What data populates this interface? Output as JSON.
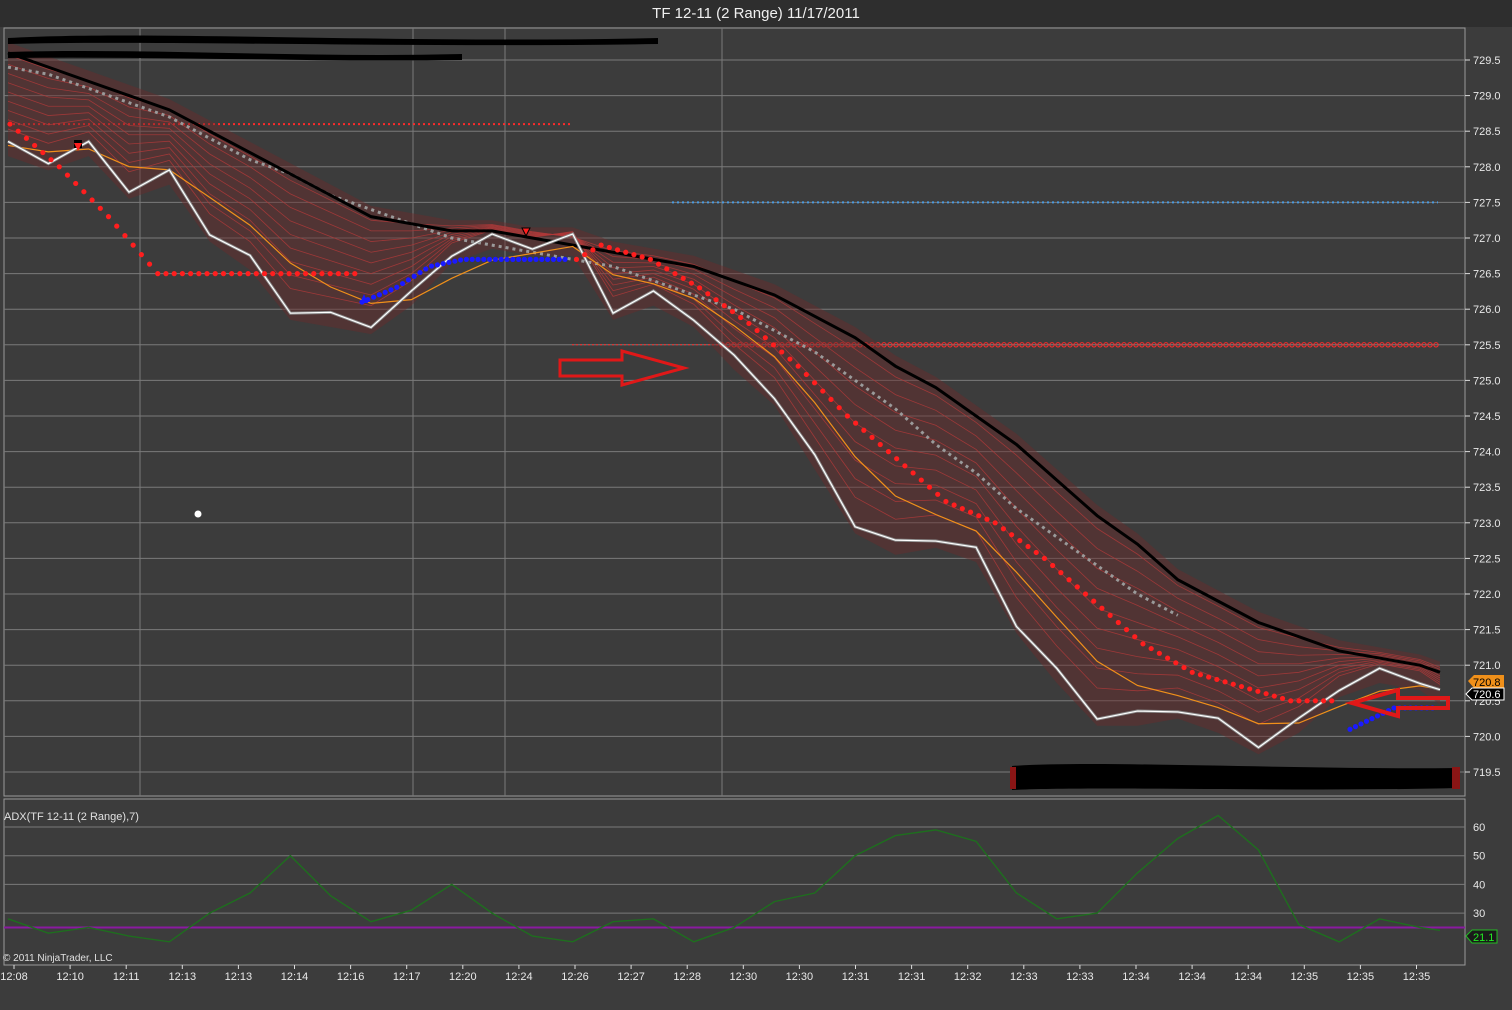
{
  "window": {
    "title": "TF 12-11 (2 Range)  11/17/2011"
  },
  "colors": {
    "background": "#3c3c3c",
    "grid": "#7a7a7a",
    "price_line": "#ffffff",
    "sma_black": "#000000",
    "sma_gray_dotted": "#9a9a9a",
    "ema_orange": "#f0901a",
    "ribbon": "#b23a3a",
    "stop_red": "#ff1e1e",
    "stop_blue": "#1a1aff",
    "level_red": "#ff2a2a",
    "level_blue": "#4a9ae0",
    "adx_line": "#1e6e1e",
    "adx_level": "#8a1aa0",
    "arrow_red": "#e01818",
    "badge_orange": "#f0901a",
    "badge_green": "#22bb22"
  },
  "price_panel": {
    "y_ticks": [
      "729.5",
      "729.0",
      "728.5",
      "728.0",
      "727.5",
      "727.0",
      "726.5",
      "726.0",
      "725.5",
      "725.0",
      "724.5",
      "724.0",
      "723.5",
      "723.0",
      "722.5",
      "722.0",
      "721.5",
      "721.0",
      "720.5",
      "720.0",
      "719.5"
    ],
    "last_price_orange": "720.8",
    "last_price_white": "720.6"
  },
  "adx_panel": {
    "label": "ADX(TF 12-11 (2 Range),7)",
    "y_ticks": [
      "60",
      "50",
      "40",
      "30"
    ],
    "last_value": "21.1",
    "copyright": "© 2011 NinjaTrader, LLC"
  },
  "x_axis": {
    "ticks": [
      "12:08",
      "12:10",
      "12:11",
      "12:13",
      "12:13",
      "12:14",
      "12:16",
      "12:17",
      "12:20",
      "12:24",
      "12:26",
      "12:27",
      "12:28",
      "12:30",
      "12:30",
      "12:31",
      "12:31",
      "12:32",
      "12:33",
      "12:33",
      "12:34",
      "12:34",
      "12:34",
      "12:35",
      "12:35",
      "12:35"
    ]
  },
  "chart_data": [
    {
      "type": "line",
      "title": "TF 12-11 (2 Range)  11/17/2011",
      "ylim": [
        719.3,
        729.8
      ],
      "x_index": [
        0,
        40,
        80,
        120,
        160,
        200,
        240,
        280,
        320,
        360,
        400,
        440,
        480,
        520,
        560,
        600,
        640,
        680,
        720,
        760,
        800,
        840,
        880,
        920,
        960,
        1000,
        1040,
        1080,
        1120,
        1160,
        1200,
        1240,
        1280,
        1320,
        1360,
        1400,
        1420
      ],
      "series": [
        {
          "values": [
            728.3,
            728.1,
            728.3,
            727.7,
            727.9,
            727.1,
            726.7,
            726.0,
            725.9,
            725.8,
            726.2,
            726.8,
            727.0,
            726.9,
            727.0,
            726.0,
            726.2,
            725.9,
            725.3,
            724.8,
            723.9,
            723.0,
            722.7,
            722.8,
            722.6,
            721.6,
            720.9,
            720.3,
            720.3,
            720.4,
            720.2,
            719.9,
            720.2,
            720.7,
            720.9,
            720.8,
            720.6
          ]
        },
        {
          "values": [
            729.6,
            729.4,
            729.2,
            729.0,
            728.8,
            728.5,
            728.2,
            727.9,
            727.6,
            727.3,
            727.2,
            727.1,
            727.1,
            727.0,
            726.9,
            726.8,
            726.7,
            726.6,
            726.4,
            726.2,
            725.9,
            725.6,
            725.2,
            724.9,
            724.5,
            724.1,
            723.6,
            723.1,
            722.7,
            722.2,
            721.9,
            721.6,
            721.4,
            721.2,
            721.1,
            721.0,
            720.9
          ]
        },
        {
          "values": [
            729.4,
            729.3,
            729.1,
            728.9,
            728.7,
            728.4,
            728.1,
            727.9,
            727.6,
            727.4,
            727.2,
            727.0,
            726.9,
            726.8,
            726.7,
            726.6,
            726.4,
            726.2,
            726.0,
            725.7,
            725.4,
            725.0,
            724.6,
            724.1,
            723.7,
            723.2,
            722.8,
            722.4,
            722.0,
            721.7
          ]
        }
      ],
      "stop_levels": {
        "red": [
          728.6,
          728.0,
          727.3,
          726.5,
          726.5,
          726.5,
          726.5,
          726.5,
          726.5,
          726.5,
          726.5,
          726.5,
          726.9,
          726.7,
          726.3,
          725.8,
          725.2,
          724.5,
          723.9,
          723.3,
          723.0,
          722.5,
          721.9,
          721.3,
          720.9,
          720.7,
          720.5
        ],
        "blue": [
          726.1,
          726.3,
          726.6,
          726.7,
          726.7,
          726.7,
          726.7
        ]
      },
      "levels": [
        {
          "value": 728.6
        },
        {
          "value": 727.5
        },
        {
          "value": 725.5
        }
      ]
    },
    {
      "type": "line",
      "title": "ADX(TF 12-11 (2 Range),7)",
      "ylim": [
        12,
        72
      ],
      "x_index": [
        0,
        40,
        80,
        120,
        160,
        200,
        240,
        280,
        320,
        360,
        400,
        440,
        480,
        520,
        560,
        600,
        640,
        680,
        720,
        760,
        800,
        840,
        880,
        920,
        960,
        1000,
        1040,
        1080,
        1120,
        1160,
        1200,
        1240,
        1280,
        1320,
        1360,
        1400,
        1420
      ],
      "series": [
        {
          "values": [
            28,
            23,
            25,
            22,
            20,
            30,
            37,
            50,
            36,
            27,
            31,
            40,
            30,
            22,
            20,
            27,
            28,
            20,
            25,
            34,
            37,
            50,
            57,
            59,
            55,
            37,
            28,
            30,
            44,
            56,
            64,
            52,
            26,
            20,
            28,
            25,
            24
          ]
        }
      ],
      "levels": [
        {
          "value": 25
        }
      ]
    }
  ]
}
